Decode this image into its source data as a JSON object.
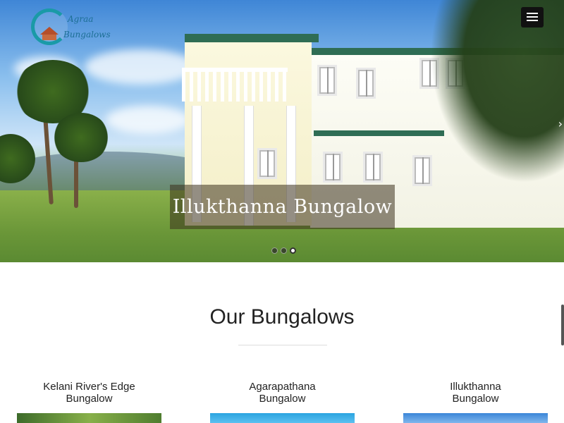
{
  "brand": {
    "line1": "Agraa",
    "line2": "Bungalows"
  },
  "hero": {
    "caption": "Illukthanna Bungalow",
    "slides": 3,
    "active_slide": 3,
    "next_arrow": "chevron-right"
  },
  "section": {
    "title": "Our Bungalows",
    "cards": [
      {
        "title_line1": "Kelani River's Edge",
        "title_line2": "Bungalow"
      },
      {
        "title_line1": "Agarapathana",
        "title_line2": "Bungalow"
      },
      {
        "title_line1": "Illukthanna",
        "title_line2": "Bungalow"
      }
    ]
  },
  "icons": {
    "menu": "hamburger-icon"
  }
}
